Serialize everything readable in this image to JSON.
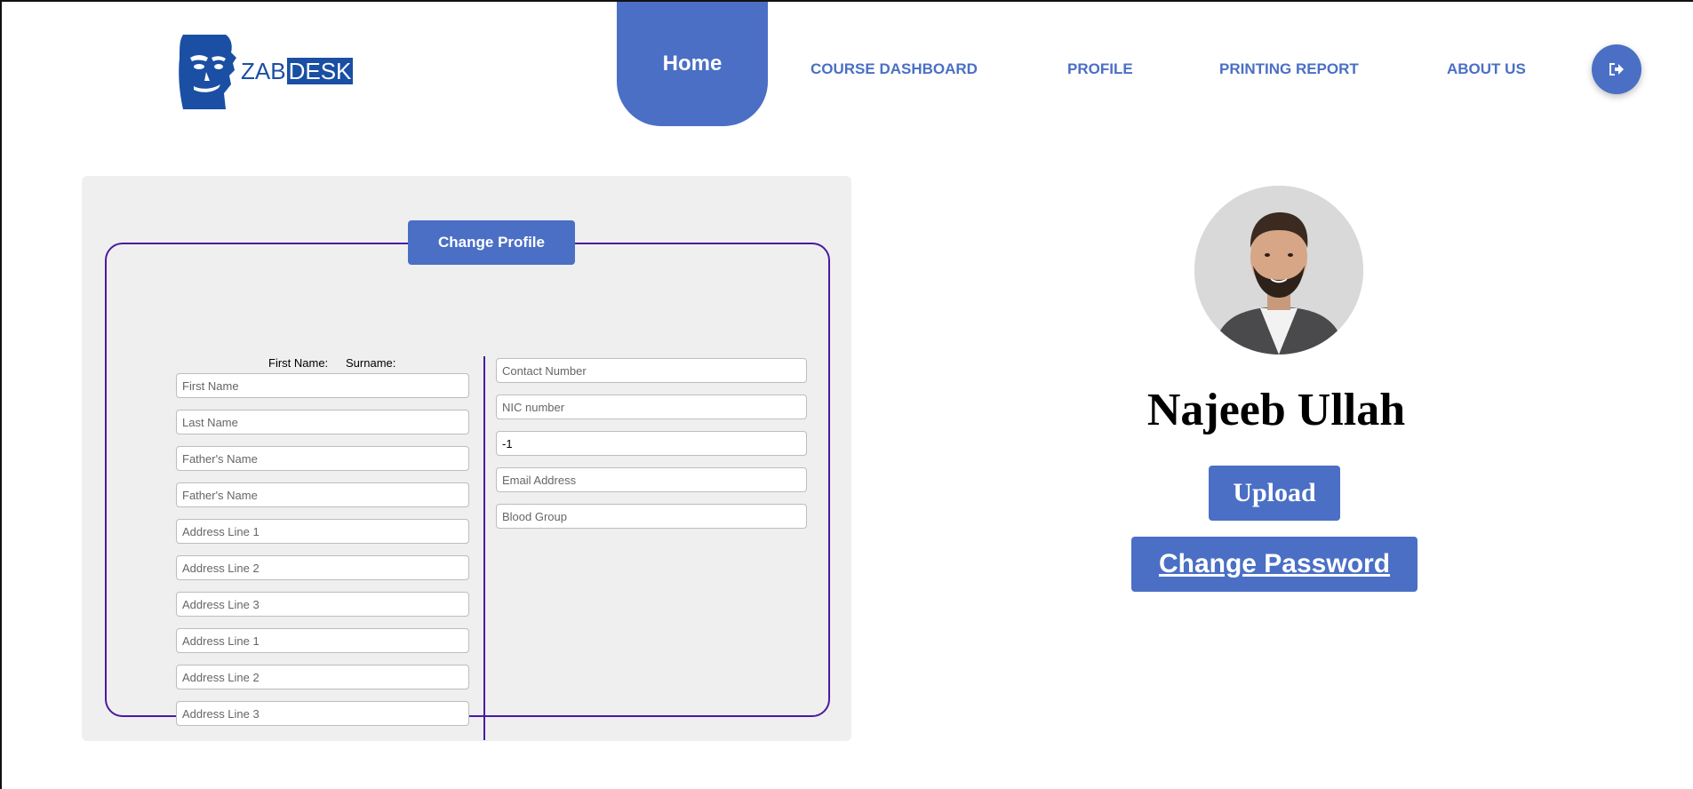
{
  "brand": {
    "logo_prefix": "ZAB",
    "logo_suffix": "DESK",
    "color": "#1a4fa3"
  },
  "nav": {
    "home": "Home",
    "course_dashboard": "COURSE DASHBOARD",
    "profile": "PROFILE",
    "printing_report": "PRINTING REPORT",
    "about_us": "ABOUT US",
    "logout_icon": "sign-out-icon",
    "accent": "#4a6fc5"
  },
  "form": {
    "legend": "Change Profile",
    "first_name_label": "First Name:",
    "surname_label": "Surname:",
    "left_fields": [
      {
        "placeholder": "First Name",
        "value": ""
      },
      {
        "placeholder": "Last Name",
        "value": ""
      },
      {
        "placeholder": "Father's Name",
        "value": ""
      },
      {
        "placeholder": "Father's Name",
        "value": ""
      },
      {
        "placeholder": "Address Line 1",
        "value": ""
      },
      {
        "placeholder": "Address Line 2",
        "value": ""
      },
      {
        "placeholder": "Address Line 3",
        "value": ""
      },
      {
        "placeholder": "Address Line 1",
        "value": ""
      },
      {
        "placeholder": "Address Line 2",
        "value": ""
      },
      {
        "placeholder": "Address Line 3",
        "value": ""
      }
    ],
    "right_fields": [
      {
        "placeholder": "Contact Number",
        "value": ""
      },
      {
        "placeholder": "NIC number",
        "value": ""
      },
      {
        "placeholder": "",
        "value": "-1"
      },
      {
        "placeholder": "Email Address",
        "value": ""
      },
      {
        "placeholder": "Blood Group",
        "value": ""
      }
    ],
    "border_color": "#4b1aa0"
  },
  "profile": {
    "name": "Najeeb Ullah",
    "upload_label": "Upload",
    "change_password_label": "Change Password"
  }
}
